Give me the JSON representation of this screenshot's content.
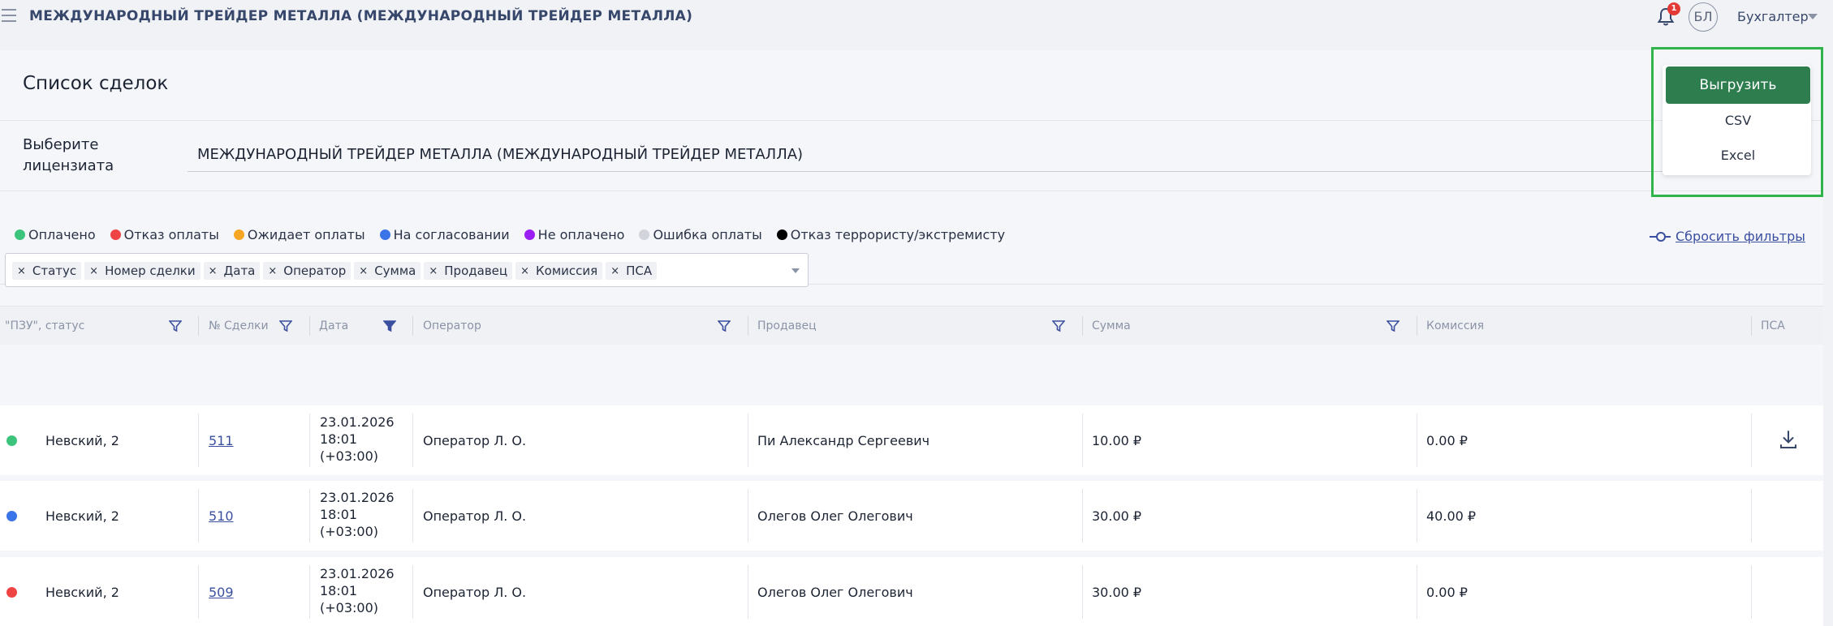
{
  "header": {
    "title": "МЕЖДУНАРОДНЫЙ ТРЕЙДЕР МЕТАЛЛА (МЕЖДУНАРОДНЫЙ ТРЕЙДЕР МЕТАЛЛА)",
    "notifications_count": "1",
    "avatar_initials": "БЛ",
    "role": "Бухгалтер"
  },
  "page": {
    "title": "Список сделок",
    "licensee_label": "Выберите лицензиата",
    "licensee_value": "МЕЖДУНАРОДНЫЙ ТРЕЙДЕР МЕТАЛЛА (МЕЖДУНАРОДНЫЙ ТРЕЙДЕР МЕТАЛЛА)",
    "reset_filters": "Сбросить фильтры"
  },
  "legend": [
    {
      "label": "Оплачено",
      "color": "#3cc47c"
    },
    {
      "label": "Отказ оплаты",
      "color": "#ef4444"
    },
    {
      "label": "Ожидает оплаты",
      "color": "#f5a623"
    },
    {
      "label": "На согласовании",
      "color": "#3b73e8"
    },
    {
      "label": "Не оплачено",
      "color": "#9b1ff2"
    },
    {
      "label": "Ошибка оплаты",
      "color": "#d1d5db"
    },
    {
      "label": "Отказ террористу/экстремисту",
      "color": "#000000"
    }
  ],
  "columns_chips": [
    "Статус",
    "Номер сделки",
    "Дата",
    "Оператор",
    "Сумма",
    "Продавец",
    "Комиссия",
    "ПСА"
  ],
  "table": {
    "headers": [
      "\"ПЗУ\", статус",
      "№ Сделки",
      "Дата",
      "Оператор",
      "Продавец",
      "Сумма",
      "Комиссия",
      "ПСА"
    ],
    "rows": [
      {
        "status_color": "#3cc47c",
        "pzu": "Невский, 2",
        "deal": "511",
        "date": "23.01.2026",
        "time": "18:01",
        "tz": "(+03:00)",
        "operator": "Оператор Л. О.",
        "seller": "Пи Александр Сергеевич",
        "sum": "10.00 ₽",
        "commission": "0.00 ₽",
        "psa_download": true
      },
      {
        "status_color": "#3b73e8",
        "pzu": "Невский, 2",
        "deal": "510",
        "date": "23.01.2026",
        "time": "18:01",
        "tz": "(+03:00)",
        "operator": "Оператор Л. О.",
        "seller": "Олегов Олег Олегович",
        "sum": "30.00 ₽",
        "commission": "40.00 ₽",
        "psa_download": false
      },
      {
        "status_color": "#ef4444",
        "pzu": "Невский, 2",
        "deal": "509",
        "date": "23.01.2026",
        "time": "18:01",
        "tz": "(+03:00)",
        "operator": "Оператор Л. О.",
        "seller": "Олегов Олег Олегович",
        "sum": "30.00 ₽",
        "commission": "0.00 ₽",
        "psa_download": false
      }
    ]
  },
  "export": {
    "button_label": "Выгрузить",
    "options": [
      "CSV",
      "Excel"
    ],
    "highlight_color": "#2fb34a"
  }
}
